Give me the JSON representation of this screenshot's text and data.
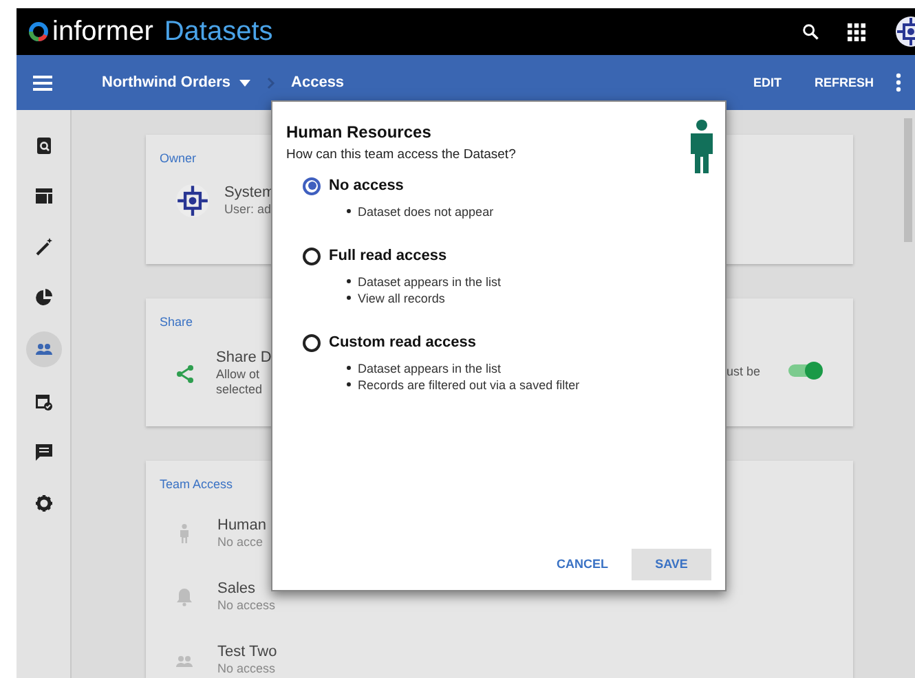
{
  "app": {
    "logo_text": "informer",
    "product": "Datasets"
  },
  "toolbar": {
    "breadcrumbs": [
      {
        "label": "Northwind Orders",
        "dropdown": true
      },
      {
        "label": "Access",
        "dropdown": false
      }
    ],
    "actions": [
      "EDIT",
      "REFRESH"
    ]
  },
  "sidebar": {
    "items": [
      {
        "selected": false
      },
      {
        "selected": false
      },
      {
        "selected": false
      },
      {
        "selected": false
      },
      {
        "selected": true
      },
      {
        "selected": false
      },
      {
        "selected": false
      },
      {
        "selected": false
      }
    ]
  },
  "owner_card": {
    "title": "Owner",
    "name": "System",
    "detail": "User: ad"
  },
  "share_card": {
    "title": "Share",
    "name": "Share D",
    "lines": [
      "Allow ot",
      "selected"
    ],
    "trailing": "ust be",
    "toggle_on": true
  },
  "team_access": {
    "title": "Team Access",
    "teams": [
      {
        "name": "Human",
        "access": "No acce"
      },
      {
        "name": "Sales",
        "access": "No access"
      },
      {
        "name": "Test Two",
        "access": "No access"
      }
    ]
  },
  "dialog": {
    "title": "Human Resources",
    "question": "How can this team access the Dataset?",
    "options": [
      {
        "label": "No access",
        "selected": true,
        "bullets": [
          "Dataset does not appear"
        ]
      },
      {
        "label": "Full read access",
        "selected": false,
        "bullets": [
          "Dataset appears in the list",
          "View all records"
        ]
      },
      {
        "label": "Custom read access",
        "selected": false,
        "bullets": [
          "Dataset appears in the list",
          "Records are filtered out via a saved filter"
        ]
      }
    ],
    "buttons": [
      {
        "label": "CANCEL",
        "kind": "text"
      },
      {
        "label": "SAVE",
        "kind": "raised"
      }
    ]
  }
}
